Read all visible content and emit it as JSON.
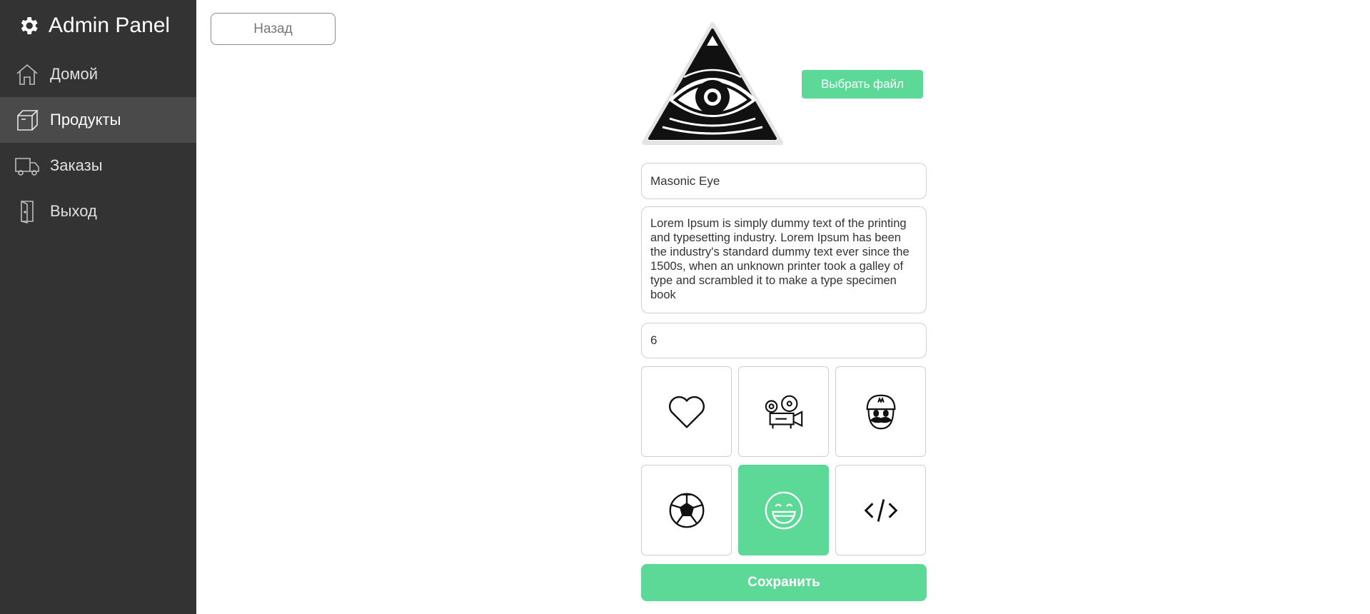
{
  "app": {
    "title": "Admin Panel"
  },
  "sidebar": {
    "items": [
      {
        "label": "Домой",
        "icon": "home-icon",
        "active": false
      },
      {
        "label": "Продукты",
        "icon": "box-icon",
        "active": true
      },
      {
        "label": "Заказы",
        "icon": "truck-icon",
        "active": false
      },
      {
        "label": "Выход",
        "icon": "door-icon",
        "active": false
      }
    ]
  },
  "toolbar": {
    "back_label": "Назад"
  },
  "product": {
    "image_icon": "all-seeing-eye-triangle",
    "choose_file_label": "Выбрать файл",
    "name": "Masonic Eye",
    "description": "Lorem Ipsum is simply dummy text of the printing and typesetting industry. Lorem Ipsum has been the industry's standard dummy text ever since the 1500s, when an unknown printer took a galley of type and scrambled it to make a type specimen book",
    "quantity": "6",
    "category_icons": [
      {
        "icon": "heart-icon",
        "selected": false
      },
      {
        "icon": "film-projector-icon",
        "selected": false
      },
      {
        "icon": "mario-face-icon",
        "selected": false
      },
      {
        "icon": "soccer-ball-icon",
        "selected": false
      },
      {
        "icon": "smile-icon",
        "selected": true
      },
      {
        "icon": "code-icon",
        "selected": false
      }
    ],
    "save_label": "Сохранить"
  },
  "colors": {
    "accent": "#5cd997",
    "sidebar_bg": "#333333",
    "sidebar_active": "#4a4a4a"
  }
}
